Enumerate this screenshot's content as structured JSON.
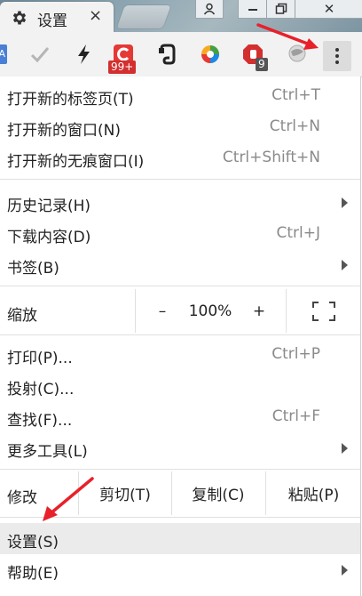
{
  "tab": {
    "title": "设置",
    "close": "×",
    "icon": "gear-icon"
  },
  "window": {
    "user_icon": "user-icon",
    "minimize_icon": "minimize-icon",
    "restore_icon": "restore-icon",
    "close": "✕"
  },
  "toolbar": {
    "icons": [
      {
        "name": "translate-extension-icon",
        "text": "A"
      },
      {
        "name": "checkmark-extension-icon"
      },
      {
        "name": "lightning-extension-icon"
      },
      {
        "name": "red-c-extension-icon",
        "badge": "99+",
        "badge_color": "#d32f2f"
      },
      {
        "name": "evernote-extension-icon"
      },
      {
        "name": "colorful-extension-icon"
      },
      {
        "name": "adblock-extension-icon",
        "badge": "9",
        "badge_color": "#555555"
      },
      {
        "name": "globe-extension-icon"
      }
    ],
    "menu_button": "menu-button"
  },
  "menu": {
    "new_tab": {
      "label": "打开新的标签页(T)",
      "shortcut": "Ctrl+T"
    },
    "new_window": {
      "label": "打开新的窗口(N)",
      "shortcut": "Ctrl+N"
    },
    "incognito": {
      "label": "打开新的无痕窗口(I)",
      "shortcut": "Ctrl+Shift+N"
    },
    "history": {
      "label": "历史记录(H)"
    },
    "downloads": {
      "label": "下载内容(D)",
      "shortcut": "Ctrl+J"
    },
    "bookmarks": {
      "label": "书签(B)"
    },
    "zoom": {
      "label": "缩放",
      "minus": "–",
      "value": "100%",
      "plus": "+",
      "fullscreen_icon": "fullscreen-icon"
    },
    "print": {
      "label": "打印(P)...",
      "shortcut": "Ctrl+P"
    },
    "cast": {
      "label": "投射(C)..."
    },
    "find": {
      "label": "查找(F)...",
      "shortcut": "Ctrl+F"
    },
    "more_tools": {
      "label": "更多工具(L)"
    },
    "edit": {
      "label": "修改",
      "cut": "剪切(T)",
      "copy": "复制(C)",
      "paste": "粘贴(P)"
    },
    "settings": {
      "label": "设置(S)"
    },
    "help": {
      "label": "帮助(E)"
    }
  },
  "colors": {
    "annotation_red": "#e8202a",
    "highlight": "#ebebeb"
  }
}
